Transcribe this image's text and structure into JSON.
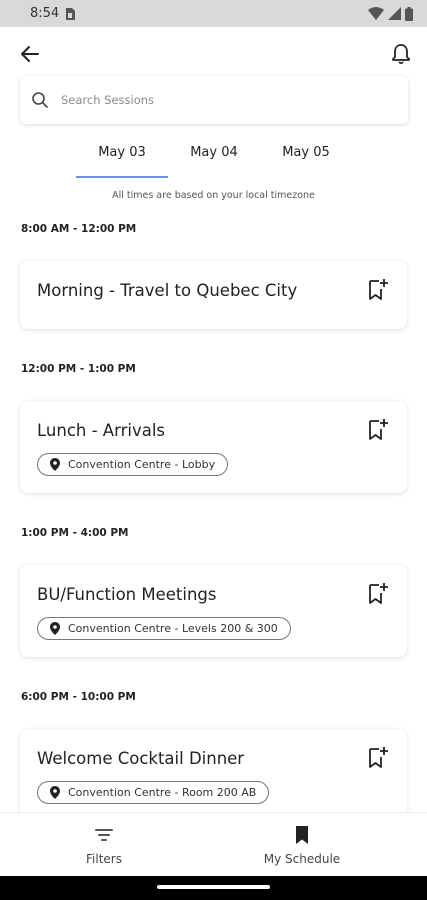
{
  "status_bar": {
    "time": "8:54"
  },
  "search": {
    "placeholder": "Search Sessions"
  },
  "tabs": [
    {
      "label": "May 03",
      "active": true
    },
    {
      "label": "May 04",
      "active": false
    },
    {
      "label": "May 05",
      "active": false
    }
  ],
  "timezone_note": "All times are based on your local timezone",
  "sessions": [
    {
      "time": "8:00 AM - 12:00 PM",
      "title": "Morning - Travel to Quebec City",
      "location": ""
    },
    {
      "time": "12:00 PM - 1:00 PM",
      "title": "Lunch - Arrivals",
      "location": "Convention Centre - Lobby"
    },
    {
      "time": "1:00 PM - 4:00 PM",
      "title": "BU/Function Meetings",
      "location": "Convention Centre - Levels 200 & 300"
    },
    {
      "time": "6:00 PM - 10:00 PM",
      "title": "Welcome Cocktail Dinner",
      "location": "Convention Centre - Room 200 AB"
    }
  ],
  "bottom_nav": {
    "filters_label": "Filters",
    "schedule_label": "My Schedule"
  },
  "colors": {
    "accent": "#6b8fd9",
    "text": "#222222"
  },
  "icons": {
    "back": "arrow-left-icon",
    "bell": "bell-icon",
    "search": "search-icon",
    "bookmark_add": "bookmark-add-icon",
    "location": "location-pin-icon",
    "filters": "filter-icon",
    "schedule": "bookmark-filled-icon"
  }
}
